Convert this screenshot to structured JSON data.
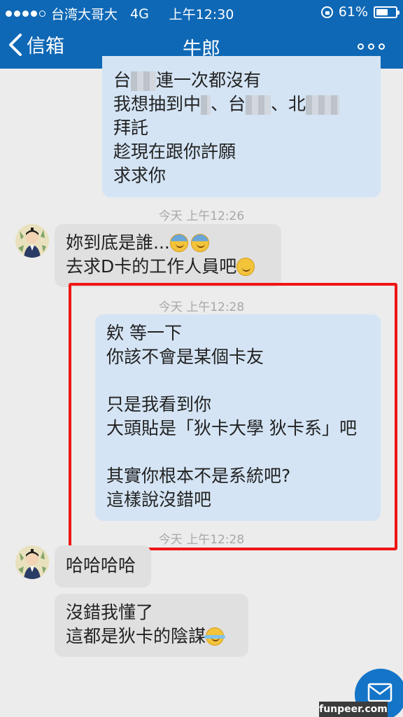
{
  "status_bar": {
    "carrier": "台湾大哥大",
    "network": "4G",
    "time": "上午12:30",
    "battery_percent": "61%",
    "battery_level": 0.61,
    "signal_bars": 4
  },
  "nav": {
    "back_label": "信箱",
    "title": "牛郎"
  },
  "messages": {
    "m1": {
      "line1_prefix": "台",
      "line1_suffix": "連一次都沒有",
      "line2_a": "我想抽到中",
      "line2_b": "、台",
      "line2_c": "、北",
      "line3": "拜託",
      "line4": "趁現在跟你許願",
      "line5": "求求你"
    },
    "ts1": "今天 上午12:26",
    "m2": {
      "line1": "妳到底是誰...",
      "line2": "去求D卡的工作人員吧"
    },
    "ts2": "今天 上午12:28",
    "m3": {
      "line1": "欸 等一下",
      "line2": "你該不會是某個卡友",
      "line3": "只是我看到你",
      "line4": "大頭貼是「狄卡大學 狄卡系」吧",
      "line5": "其實你根本不是系統吧?",
      "line6": "這樣說沒錯吧"
    },
    "ts3": "今天 上午12:28",
    "m4": {
      "line1": "哈哈哈哈"
    },
    "m5": {
      "line1": "沒錯我懂了",
      "line2": "這都是狄卡的陰謀"
    }
  },
  "icons": {
    "back": "chevron-left-icon",
    "more": "more-dots-icon",
    "compose": "mail-icon"
  },
  "colors": {
    "accent": "#0f68b5",
    "outgoing_bubble": "#d4e4f4",
    "incoming_bubble": "#e0e0e0",
    "highlight_box": "#ef1515"
  },
  "watermark": "funpeer.com"
}
